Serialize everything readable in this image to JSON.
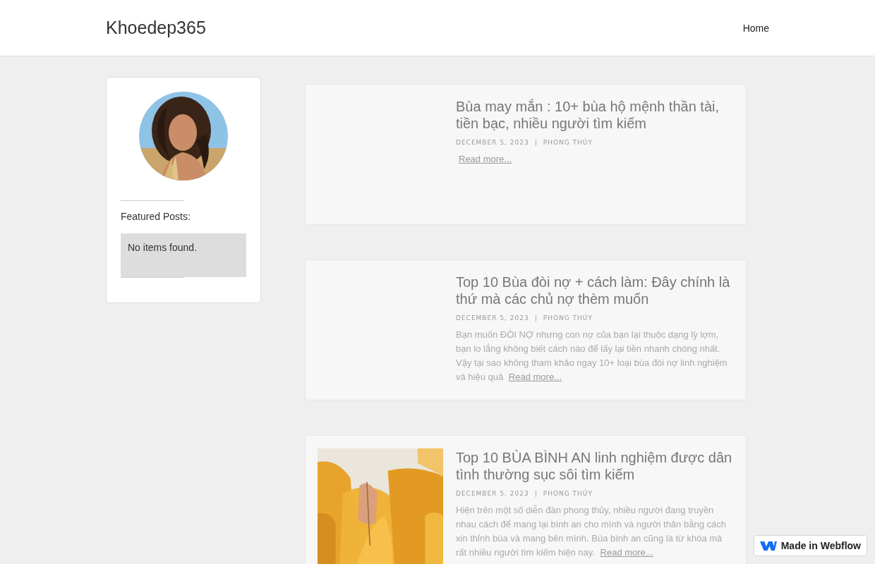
{
  "site": {
    "title": "Khoedep365"
  },
  "nav": [
    {
      "label": "Home"
    }
  ],
  "sidebar": {
    "heading": "Featured Posts:",
    "empty_message": "No items found."
  },
  "posts": [
    {
      "title": "Bùa may mắn : 10+ bùa hộ mệnh thần tài, tiền bạc, nhiều người tìm kiếm",
      "date": "DECEMBER 5, 2023",
      "separator": "|",
      "category": "PHONG THỦY",
      "read_more": "Read more..."
    },
    {
      "title": "Top 10 Bùa đòi nợ + cách làm: Đây chính là thứ mà các chủ nợ thèm muốn",
      "date": "DECEMBER 5, 2023",
      "separator": "|",
      "category": "PHONG THỦY",
      "excerpt": "Bạn muốn ĐÒI NỢ nhưng con nợ của bạn lại thuộc dạng lỳ lợm, bạn lo lắng không biết cách nào để lấy lại tiền nhanh chóng nhất. Vậy tại sao không tham khảo ngay 10+ loại bùa đòi nợ linh nghiệm và hiệu quả",
      "read_more": "Read more..."
    },
    {
      "title": "Top 10 BÙA BÌNH AN linh nghiệm được dân tình thường sục sôi tìm kiếm",
      "date": "DECEMBER 5, 2023",
      "separator": "|",
      "category": "PHONG THỦY",
      "excerpt": "Hiện trên một số diễn đàn phong thủy, nhiều người đang truyền nhau cách để mang lại bình an cho mình và người thân bằng cách xin thỉnh bùa và mang bên mình. Bùa bình an cũng là từ khóa mà rất nhiều người tìm kiếm hiện nay.",
      "read_more": "Read more..."
    }
  ],
  "badge": {
    "label": "Made in Webflow"
  }
}
